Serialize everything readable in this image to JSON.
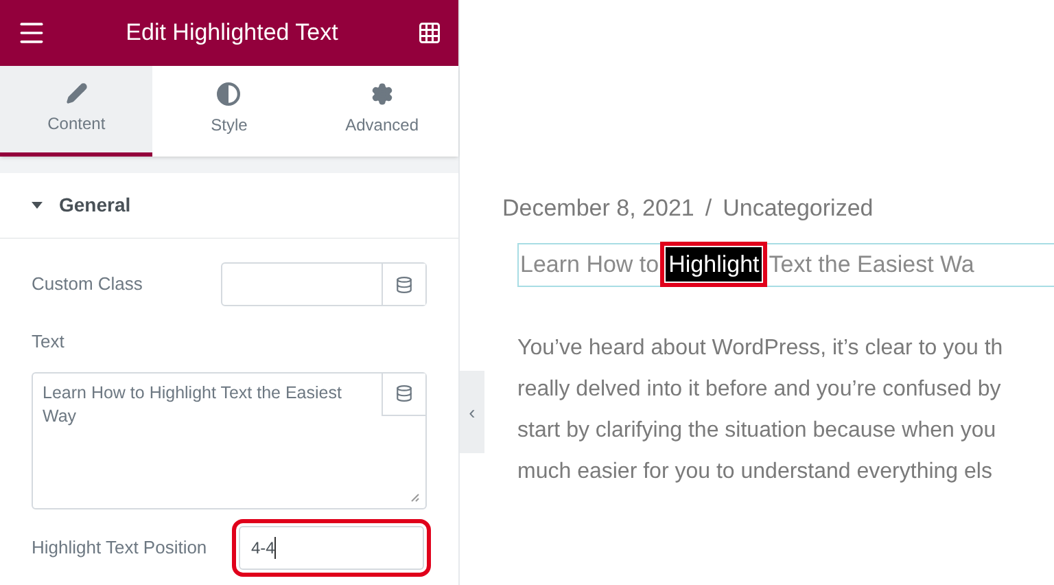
{
  "panel": {
    "title": "Edit Highlighted Text",
    "tabs": [
      {
        "label": "Content",
        "selected": true
      },
      {
        "label": "Style",
        "selected": false
      },
      {
        "label": "Advanced",
        "selected": false
      }
    ],
    "section": {
      "title": "General",
      "expanded": true
    },
    "fields": [
      {
        "kind": "input",
        "label": "Custom Class",
        "dynamic": true,
        "annotated": false
      },
      {
        "kind": "textarea",
        "label": "Text",
        "lines": [
          "Learn How to Highlight Text the Easiest",
          "Way"
        ],
        "dynamic": true,
        "annotated": false
      },
      {
        "kind": "input",
        "label": "Highlight Text Position",
        "value": "4-4",
        "dynamic": false,
        "annotated": true
      }
    ]
  },
  "collapse_toggle": "‹",
  "post": {
    "date": "December 8, 2021",
    "separator": "/",
    "category": "Uncategorized",
    "title_parts": [
      {
        "text": "Learn How to",
        "highlighted": false
      },
      {
        "text": "Highlight",
        "highlighted": true
      },
      {
        "text": "Text the Easiest Wa",
        "highlighted": false
      }
    ],
    "paragraph_lines": [
      "You’ve heard about WordPress, it’s clear to you th",
      "really delved into it before and you’re confused by",
      "start by clarifying the situation because when you",
      "much easier for you to understand everything els"
    ]
  }
}
